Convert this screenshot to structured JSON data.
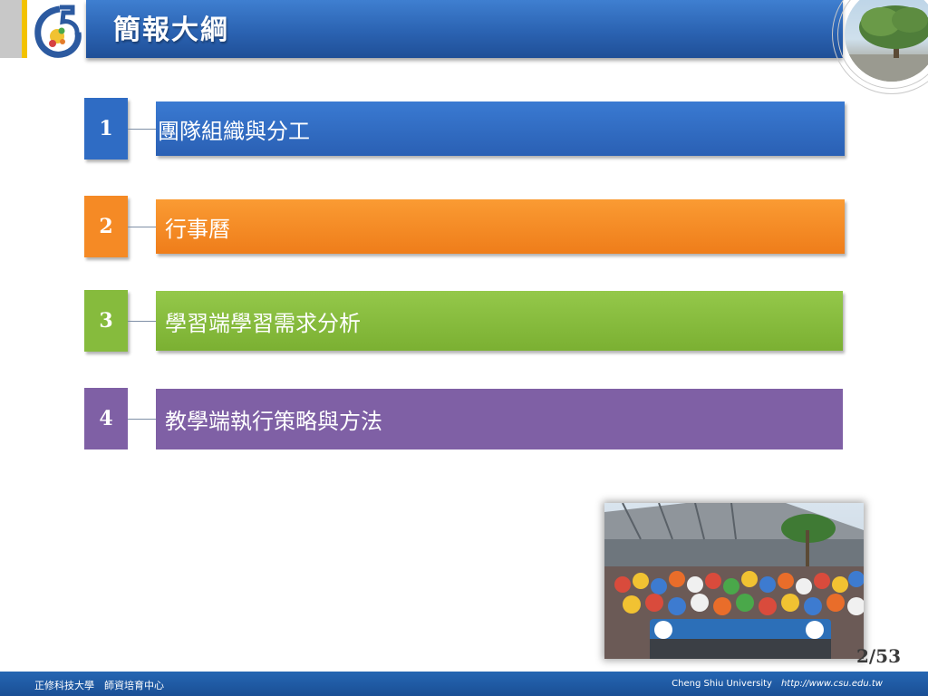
{
  "header": {
    "title": "簡報大綱"
  },
  "agenda": [
    {
      "number": "1",
      "label": "團隊組織與分工",
      "color": "#2f6cc4"
    },
    {
      "number": "2",
      "label": "行事曆",
      "color": "#f58a25"
    },
    {
      "number": "3",
      "label": "學習端學習需求分析",
      "color": "#86bb3d"
    },
    {
      "number": "4",
      "label": "教學端執行策略與方法",
      "color": "#7f60a5"
    }
  ],
  "page_number": "2/53",
  "footer": {
    "org": "正修科技大學　師資培育中心",
    "university": "Cheng Shiu University",
    "url": "http://www.csu.edu.tw"
  },
  "colors": {
    "header_blue": "#2b63b2",
    "footer_blue": "#1f5aa3",
    "accent_yellow": "#f2c200"
  },
  "icons": [
    "school-logo",
    "tree-photo",
    "group-photo"
  ]
}
